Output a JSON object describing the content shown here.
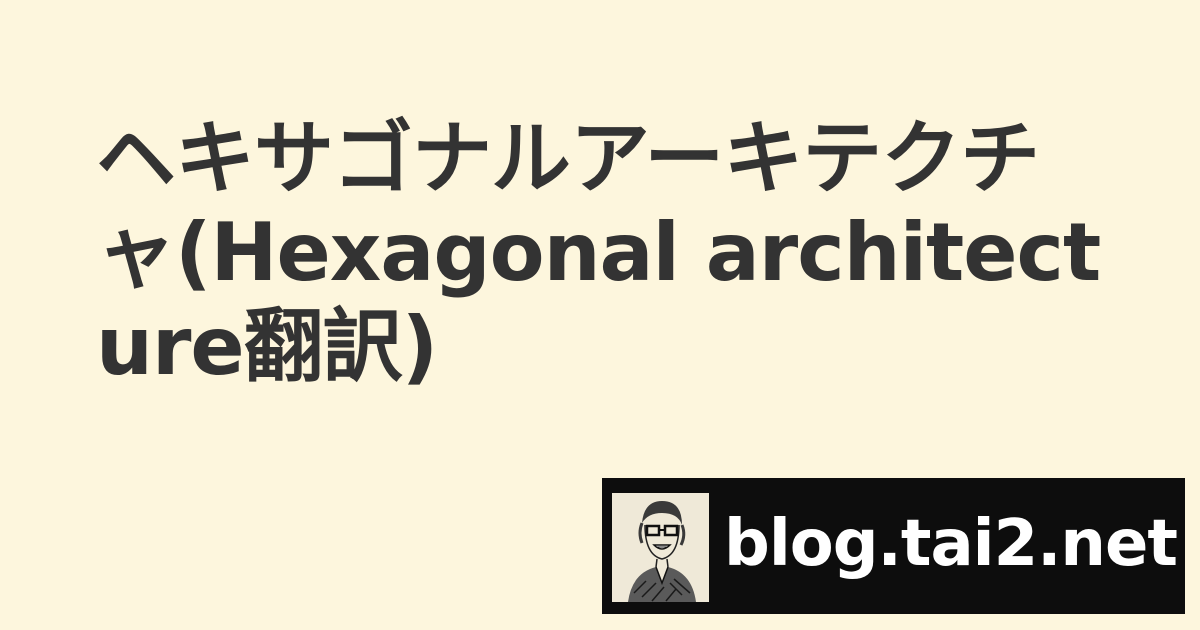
{
  "title": "ヘキサゴナルアーキテクチャ(Hexagonal architecture翻訳)",
  "brand": {
    "site_name": "blog.tai2.net",
    "avatar_icon": "author-portrait-sketch-icon"
  },
  "colors": {
    "background": "#fdf6dd",
    "title_text": "#333333",
    "brand_bar": "#0d0d0d",
    "brand_text": "#ffffff"
  }
}
